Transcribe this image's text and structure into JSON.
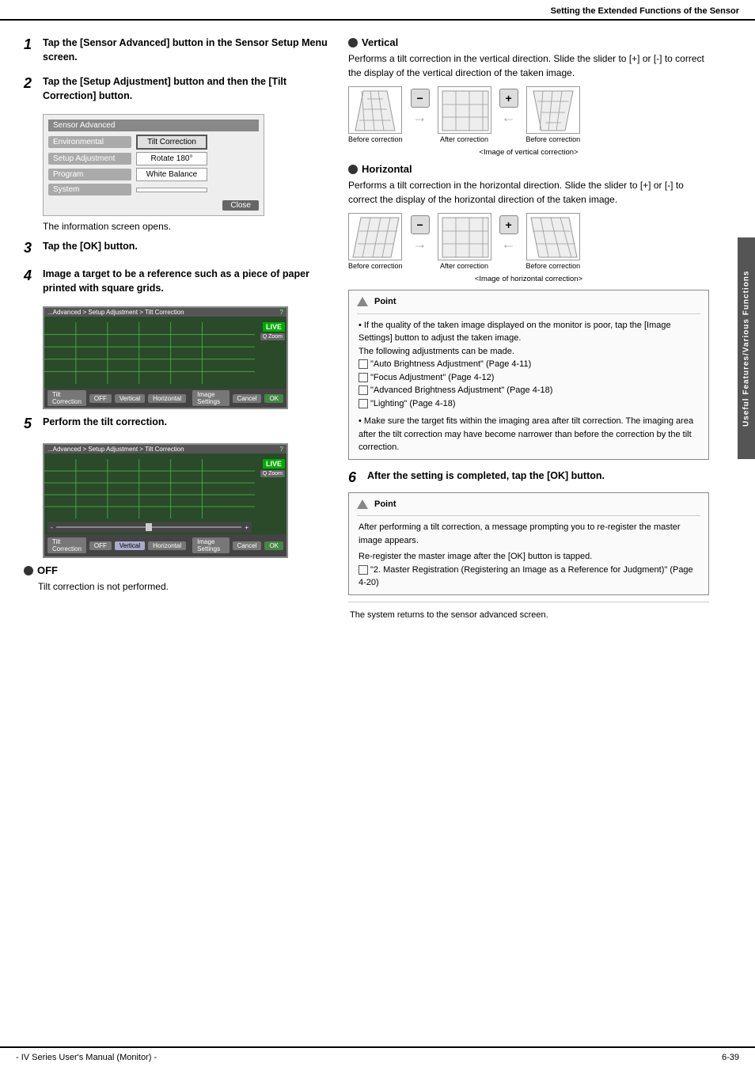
{
  "header": {
    "title": "Setting the Extended Functions of the Sensor"
  },
  "footer": {
    "left": "- IV Series User's Manual (Monitor) -",
    "right": "6-39"
  },
  "side_tab": "Useful Features/Various Functions",
  "step1": {
    "num": "1",
    "text": "Tap the [Sensor Advanced] button in the Sensor Setup Menu screen."
  },
  "step2": {
    "num": "2",
    "text": "Tap the [Setup Adjustment] button and then the [Tilt Correction] button."
  },
  "sensor_advanced": {
    "title": "Sensor Advanced",
    "rows": [
      {
        "left": "Environmental",
        "right": "Tilt Correction",
        "highlight": true
      },
      {
        "left": "Setup Adjustment",
        "right": "Rotate 180°",
        "highlight": false
      },
      {
        "left": "Program",
        "right": "White Balance",
        "highlight": false
      },
      {
        "left": "System",
        "right": "",
        "highlight": false
      }
    ],
    "close": "Close"
  },
  "info_text": "The information screen opens.",
  "step3": {
    "num": "3",
    "text": "Tap the [OK] button."
  },
  "step4": {
    "num": "4",
    "text": "Image a target to be a reference such as a piece of paper printed with square grids."
  },
  "step5": {
    "num": "5",
    "text": "Perform the tilt correction."
  },
  "off_section": {
    "title": "OFF",
    "body": "Tilt correction is not performed."
  },
  "vertical_section": {
    "title": "Vertical",
    "body": "Performs a tilt correction in the vertical direction. Slide the slider to [+] or [-] to correct the display of the vertical direction of the taken image.",
    "before_label": "Before correction",
    "after_label": "After correction",
    "before_label2": "Before correction",
    "caption": "<Image of vertical correction>"
  },
  "horizontal_section": {
    "title": "Horizontal",
    "body": "Performs a tilt correction in the horizontal direction. Slide the slider to [+] or [-] to correct the display of the horizontal direction of the taken image.",
    "before_label": "Before correction",
    "after_label": "After correction",
    "before_label2": "Before correction",
    "caption": "<Image of horizontal correction>"
  },
  "point_box1": {
    "header": "Point",
    "bullets": [
      "If the quality of the taken image displayed on the monitor is poor, tap the [Image Settings] button to adjust the taken image.",
      "The following adjustments can be made.",
      "\"Auto Brightness Adjustment\" (Page 4-11)",
      "\"Focus Adjustment\" (Page 4-12)",
      "\"Advanced Brightness Adjustment\" (Page 4-18)",
      "\"Lighting\" (Page 4-18)",
      "Make sure the target fits within the imaging area after tilt correction. The imaging area after the tilt correction may have become narrower than before the correction by the tilt correction."
    ]
  },
  "step6": {
    "num": "6",
    "text": "After the setting is completed, tap the [OK] button."
  },
  "point_box2": {
    "header": "Point",
    "text1": "After performing a tilt correction, a message prompting you to re-register the master image appears.",
    "text2": "Re-register the master image after the [OK] button is tapped.",
    "text3": "\"2. Master Registration (Registering an Image as a Reference for Judgment)\" (Page 4-20)"
  },
  "end_text": "The system returns to the sensor advanced screen.",
  "screen1": {
    "nav": "...Advanced > Setup Adjustment > Tilt Correction",
    "live": "LIVE",
    "zoom": "Q Zoom",
    "bottom_items": [
      "Tilt Correction",
      "OFF",
      "Vertical",
      "Horizontal"
    ],
    "bottom_btns": [
      "Image Settings",
      "Cancel",
      "OK"
    ]
  },
  "screen2": {
    "nav": "...Advanced > Setup Adjustment > Tilt Correction",
    "live": "LIVE",
    "zoom": "Q Zoom",
    "slider": "slider",
    "bottom_items": [
      "Tilt Correction",
      "OFF",
      "Vertical",
      "Horizontal"
    ],
    "bottom_btns": [
      "Image Settings",
      "Cancel",
      "OK"
    ]
  }
}
